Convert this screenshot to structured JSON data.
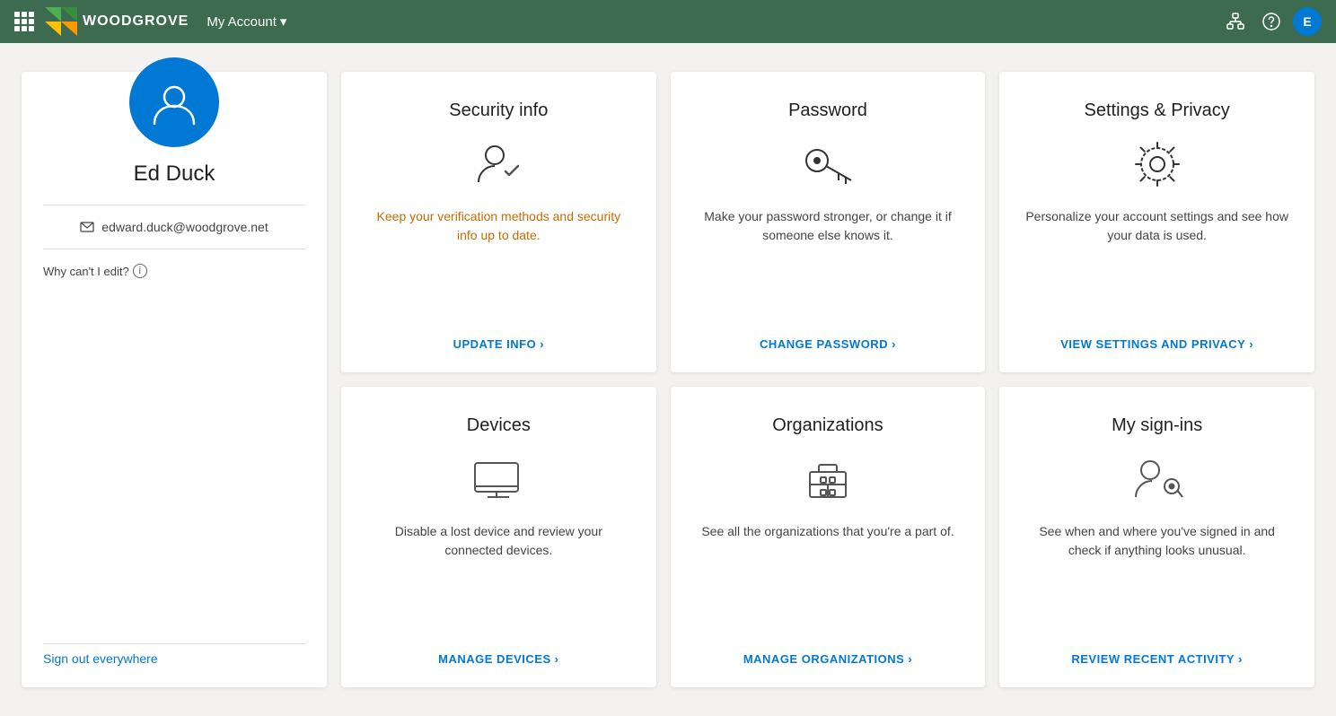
{
  "header": {
    "logo_text": "WOODGROVE",
    "account_label": "My Account",
    "chevron": "▾",
    "icons": {
      "grid": "grid-icon",
      "help": "?",
      "user_initials": "E"
    }
  },
  "profile": {
    "name": "Ed Duck",
    "email": "edward.duck@woodgrove.net",
    "edit_note": "Why can't I edit?",
    "sign_out": "Sign out everywhere"
  },
  "cards": [
    {
      "id": "security-info",
      "title": "Security info",
      "description": "Keep your verification methods and security info up to date.",
      "desc_class": "orange",
      "link_label": "UPDATE INFO",
      "link_arrow": "›"
    },
    {
      "id": "password",
      "title": "Password",
      "description": "Make your password stronger, or change it if someone else knows it.",
      "desc_class": "",
      "link_label": "CHANGE PASSWORD",
      "link_arrow": "›"
    },
    {
      "id": "settings-privacy",
      "title": "Settings & Privacy",
      "description": "Personalize your account settings and see how your data is used.",
      "desc_class": "",
      "link_label": "VIEW SETTINGS AND PRIVACY",
      "link_arrow": "›"
    },
    {
      "id": "devices",
      "title": "Devices",
      "description": "Disable a lost device and review your connected devices.",
      "desc_class": "",
      "link_label": "MANAGE DEVICES",
      "link_arrow": "›"
    },
    {
      "id": "organizations",
      "title": "Organizations",
      "description": "See all the organizations that you're a part of.",
      "desc_class": "",
      "link_label": "MANAGE ORGANIZATIONS",
      "link_arrow": "›"
    },
    {
      "id": "my-sign-ins",
      "title": "My sign-ins",
      "description": "See when and where you've signed in and check if anything looks unusual.",
      "desc_class": "",
      "link_label": "REVIEW RECENT ACTIVITY",
      "link_arrow": "›"
    }
  ]
}
